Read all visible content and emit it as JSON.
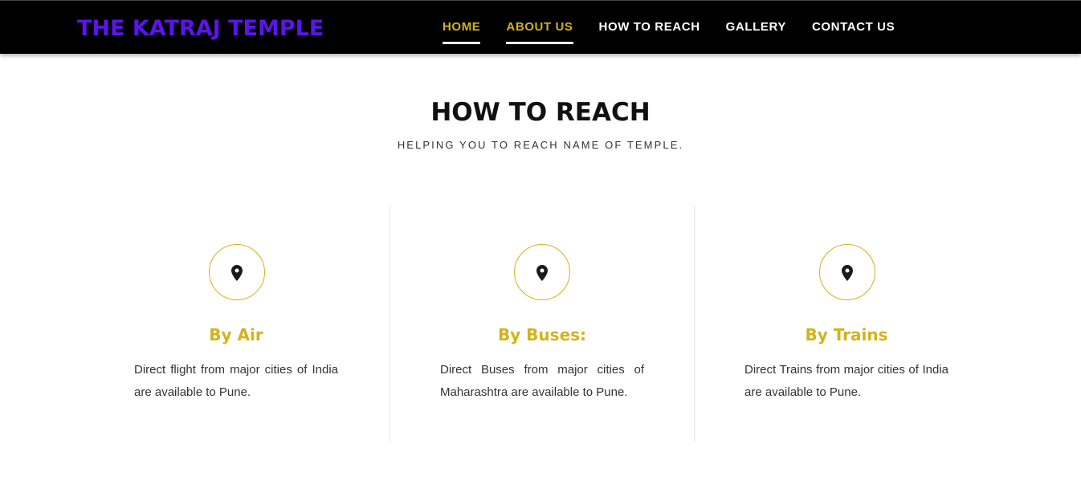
{
  "colors": {
    "brand": "#5b15e8",
    "accent_gold": "#d4b21c",
    "nav_background": "#000000",
    "nav_text": "#ffffff"
  },
  "header": {
    "brand": "THE KATRAJ TEMPLE",
    "nav": [
      {
        "label": "HOME",
        "active": true
      },
      {
        "label": "ABOUT US",
        "active": true
      },
      {
        "label": "HOW TO REACH",
        "active": false
      },
      {
        "label": "GALLERY",
        "active": false
      },
      {
        "label": "CONTACT US",
        "active": false
      }
    ]
  },
  "main": {
    "title": "HOW TO REACH",
    "subtitle": "HELPING YOU TO REACH NAME OF TEMPLE.",
    "cards": [
      {
        "icon": "map-marker-icon",
        "title": "By Air",
        "text": "Direct flight from major cities of India are available to Pune."
      },
      {
        "icon": "map-marker-icon",
        "title": "By Buses:",
        "text": "Direct Buses from major cities of Maharashtra are available to Pune."
      },
      {
        "icon": "map-marker-icon",
        "title": "By Trains",
        "text": "Direct Trains from major cities of India are available to Pune."
      }
    ]
  }
}
